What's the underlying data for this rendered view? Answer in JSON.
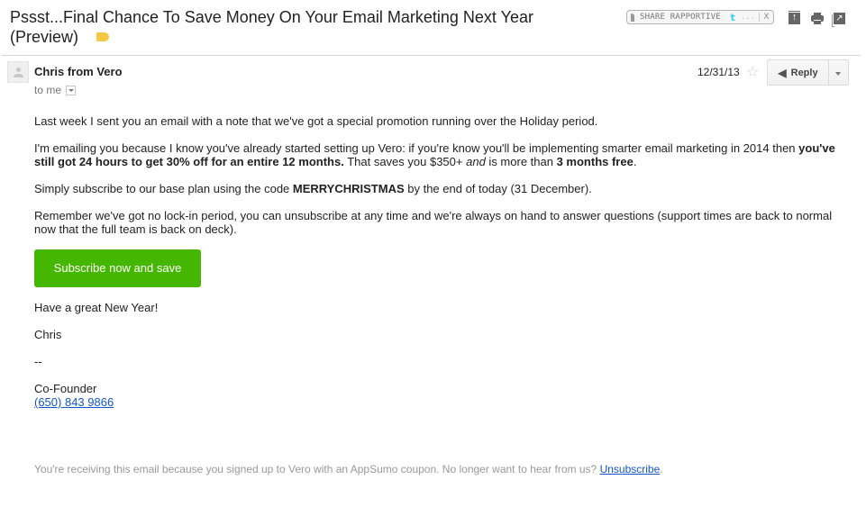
{
  "subject": {
    "title": "Pssst...Final Chance To Save Money On Your Email Marketing Next Year (Preview)",
    "label_color": "#f5c842"
  },
  "rapportive": {
    "label": "SHARE RAPPORTIVE",
    "twitter_glyph": "t",
    "more": "...",
    "close": "X"
  },
  "toolbar": {
    "icons": [
      "scroll-to-top-icon",
      "print-icon",
      "open-in-new-window-icon"
    ]
  },
  "message": {
    "sender": "Chris from Vero",
    "recipient": "to me",
    "date": "12/31/13",
    "reply_label": "Reply"
  },
  "body": {
    "p1": "Last week I sent you an email with a note that we've got a special promotion running over the Holiday period.",
    "p2_a": "I'm emailing you because I know you've already started setting up Vero: if you're know you'll be implementing smarter email marketing in 2014 then ",
    "p2_bold": "you've still got 24 hours to get 30% off for an entire 12 months.",
    "p2_b": " That saves you $350+ ",
    "p2_italic": "and",
    "p2_c": " is more than ",
    "p2_bold2": "3 months free",
    "p2_d": ".",
    "p3_a": "Simply subscribe to our base plan using the code ",
    "p3_code": "MERRYCHRISTMAS",
    "p3_b": " by the end of today (31 December).",
    "p4": "Remember we've got no lock-in period, you can unsubscribe at any time and we're always on hand to answer questions (support times are back to normal now that the full team is back on deck).",
    "cta_label": "Subscribe now and save",
    "cta_color": "#45b700",
    "closing": "Have a great New Year!",
    "signature_name": "Chris",
    "sig_sep": "--",
    "sig_title": "Co-Founder",
    "sig_phone": "(650) 843 9866"
  },
  "footer": {
    "text": "You're receiving this email because you signed up to Vero with an AppSumo coupon. No longer want to hear from us? ",
    "unsubscribe": "Unsubscribe",
    "end": "."
  }
}
